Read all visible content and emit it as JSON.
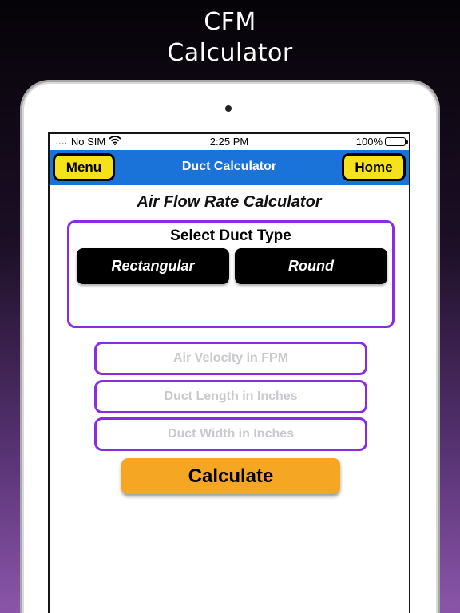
{
  "promo": {
    "line1": "CFM",
    "line2": "Calculator"
  },
  "status_bar": {
    "carrier": "No SIM",
    "signal_dots": ".....",
    "time": "2:25 PM",
    "battery": "100%"
  },
  "nav": {
    "title": "Duct Calculator",
    "menu_label": "Menu",
    "home_label": "Home"
  },
  "page": {
    "title": "Air Flow Rate Calculator"
  },
  "duct_type": {
    "heading": "Select Duct Type",
    "options": [
      "Rectangular",
      "Round"
    ]
  },
  "fields": {
    "velocity_placeholder": "Air Velocity in FPM",
    "length_placeholder": "Duct Length in Inches",
    "width_placeholder": "Duct Width in Inches"
  },
  "actions": {
    "calculate_label": "Calculate"
  },
  "colors": {
    "nav_bar": "#1a73d8",
    "nav_button": "#f5e21a",
    "accent_border": "#8a2be2",
    "calculate_button": "#f5a623"
  }
}
